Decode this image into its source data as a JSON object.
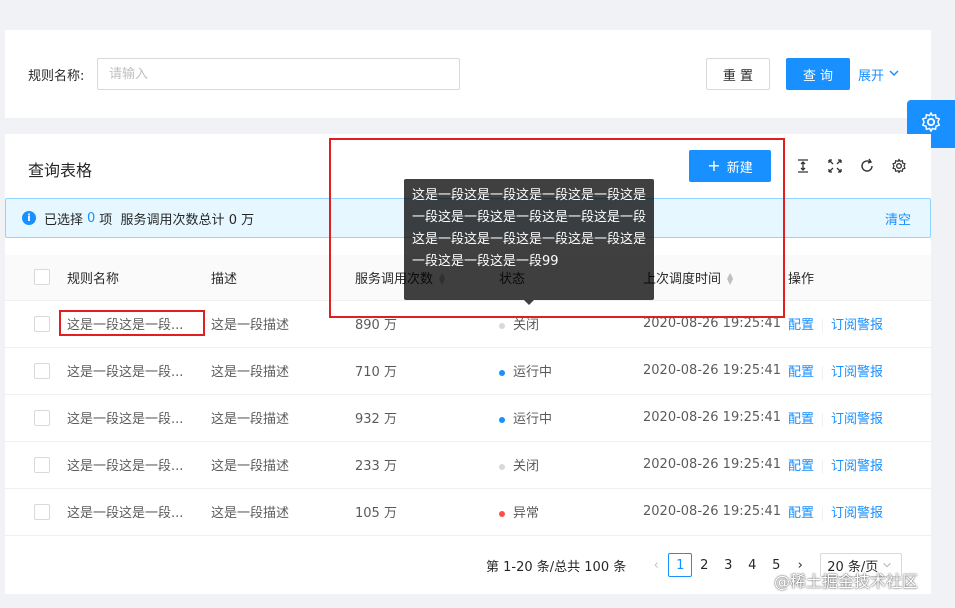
{
  "search": {
    "label": "规则名称:",
    "placeholder": "请输入",
    "reset_label": "重 置",
    "query_label": "查 询",
    "expand_label": "展开"
  },
  "table_card": {
    "title": "查询表格",
    "new_label": "新建"
  },
  "alert": {
    "prefix": "已选择",
    "count": "0",
    "suffix": "项  服务调用次数总计 0 万",
    "clear_label": "清空"
  },
  "columns": [
    "规则名称",
    "描述",
    "服务调用次数",
    "状态",
    "上次调度时间",
    "操作"
  ],
  "rows": [
    {
      "name": "这是一段这是一段...",
      "desc": "这是一段描述",
      "calls": "890 万",
      "status": "关闭",
      "status_color": "#d9d9d9",
      "time": "2020-08-26 19:25:41"
    },
    {
      "name": "这是一段这是一段...",
      "desc": "这是一段描述",
      "calls": "710 万",
      "status": "运行中",
      "status_color": "#1890ff",
      "time": "2020-08-26 19:25:41"
    },
    {
      "name": "这是一段这是一段...",
      "desc": "这是一段描述",
      "calls": "932 万",
      "status": "运行中",
      "status_color": "#1890ff",
      "time": "2020-08-26 19:25:41"
    },
    {
      "name": "这是一段这是一段...",
      "desc": "这是一段描述",
      "calls": "233 万",
      "status": "关闭",
      "status_color": "#d9d9d9",
      "time": "2020-08-26 19:25:41"
    },
    {
      "name": "这是一段这是一段...",
      "desc": "这是一段描述",
      "calls": "105 万",
      "status": "异常",
      "status_color": "#ff4d4f",
      "time": "2020-08-26 19:25:41"
    }
  ],
  "row_actions": {
    "config": "配置",
    "subscribe": "订阅警报"
  },
  "tooltip": {
    "text": "这是一段这是一段这是一段这是一段这是一段这是一段这是一段这是一段这是一段这是一段这是一段这是一段这是一段这是一段这是一段这是一段99"
  },
  "pagination": {
    "total_text": "第 1-20 条/总共 100 条",
    "pages": [
      "1",
      "2",
      "3",
      "4",
      "5"
    ],
    "current": "1",
    "page_size": "20 条/页"
  },
  "watermark": "@稀土掘金技术社区",
  "colors": {
    "primary": "#1890ff",
    "highlight_box": "#e02020"
  }
}
